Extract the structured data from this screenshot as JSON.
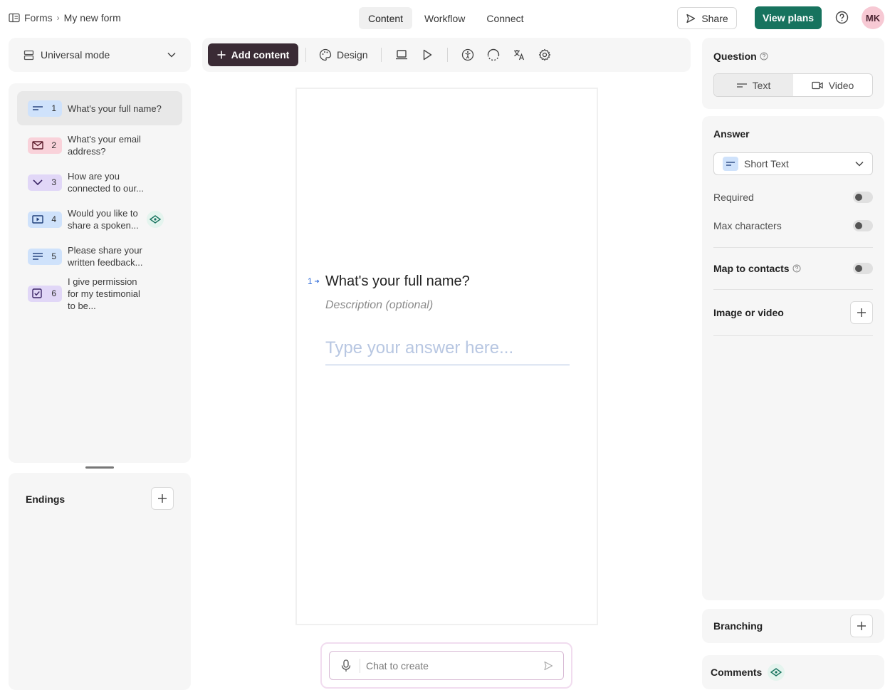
{
  "breadcrumb": {
    "root": "Forms",
    "separator": "›",
    "current": "My new form"
  },
  "nav_tabs": [
    {
      "label": "Content"
    },
    {
      "label": "Workflow"
    },
    {
      "label": "Connect"
    }
  ],
  "header": {
    "share_label": "Share",
    "view_plans_label": "View plans",
    "avatar_initials": "MK"
  },
  "sidebar": {
    "mode_label": "Universal mode",
    "questions": [
      {
        "num": "1",
        "text": "What's your full name?",
        "type": "short-text",
        "color": "#cfe2fb"
      },
      {
        "num": "2",
        "text": "What's your email address?",
        "type": "email",
        "color": "#f9d2da"
      },
      {
        "num": "3",
        "text": "How are you connected to our...",
        "type": "dropdown",
        "color": "#e1d7f7"
      },
      {
        "num": "4",
        "text": "Would you like to share a spoken...",
        "type": "video",
        "color": "#cfe2fb"
      },
      {
        "num": "5",
        "text": "Please share your written feedback...",
        "type": "long-text",
        "color": "#cfe2fb"
      },
      {
        "num": "6",
        "text": "I give permission for my testimonial to be...",
        "type": "checkbox",
        "color": "#e1d7f7"
      }
    ],
    "endings_label": "Endings"
  },
  "toolbar": {
    "add_content_label": "Add content",
    "design_label": "Design"
  },
  "canvas": {
    "question_number": "1",
    "question_title": "What's your full name?",
    "description_placeholder": "Description (optional)",
    "answer_placeholder": "Type your answer here..."
  },
  "chat": {
    "placeholder": "Chat to create"
  },
  "right_panel": {
    "question_section": "Question",
    "question_types": [
      {
        "label": "Text"
      },
      {
        "label": "Video"
      }
    ],
    "answer_section": "Answer",
    "answer_type": "Short Text",
    "required_label": "Required",
    "max_chars_label": "Max characters",
    "map_contacts_label": "Map to contacts",
    "image_video_label": "Image or video",
    "branching_label": "Branching",
    "comments_label": "Comments"
  },
  "colors": {
    "accent": "#17735e",
    "add_button": "#3a2b35",
    "avatar": "#f7c9d4"
  }
}
